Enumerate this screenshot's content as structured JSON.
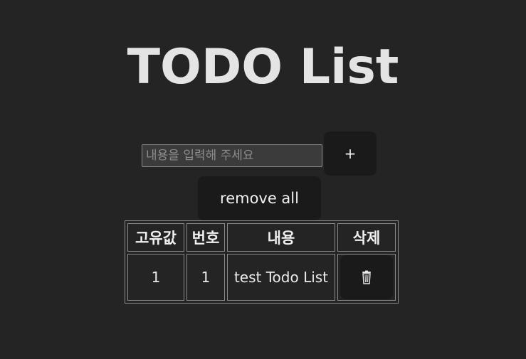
{
  "app": {
    "title": "TODO List"
  },
  "input": {
    "placeholder": "내용을 입력해 주세요",
    "value": ""
  },
  "buttons": {
    "add_label": "+",
    "remove_all_label": "remove all"
  },
  "table": {
    "headers": [
      "고유값",
      "번호",
      "내용",
      "삭제"
    ],
    "rows": [
      {
        "id": "1",
        "number": "1",
        "content": "test Todo List",
        "delete_icon": "trash-icon"
      }
    ]
  }
}
